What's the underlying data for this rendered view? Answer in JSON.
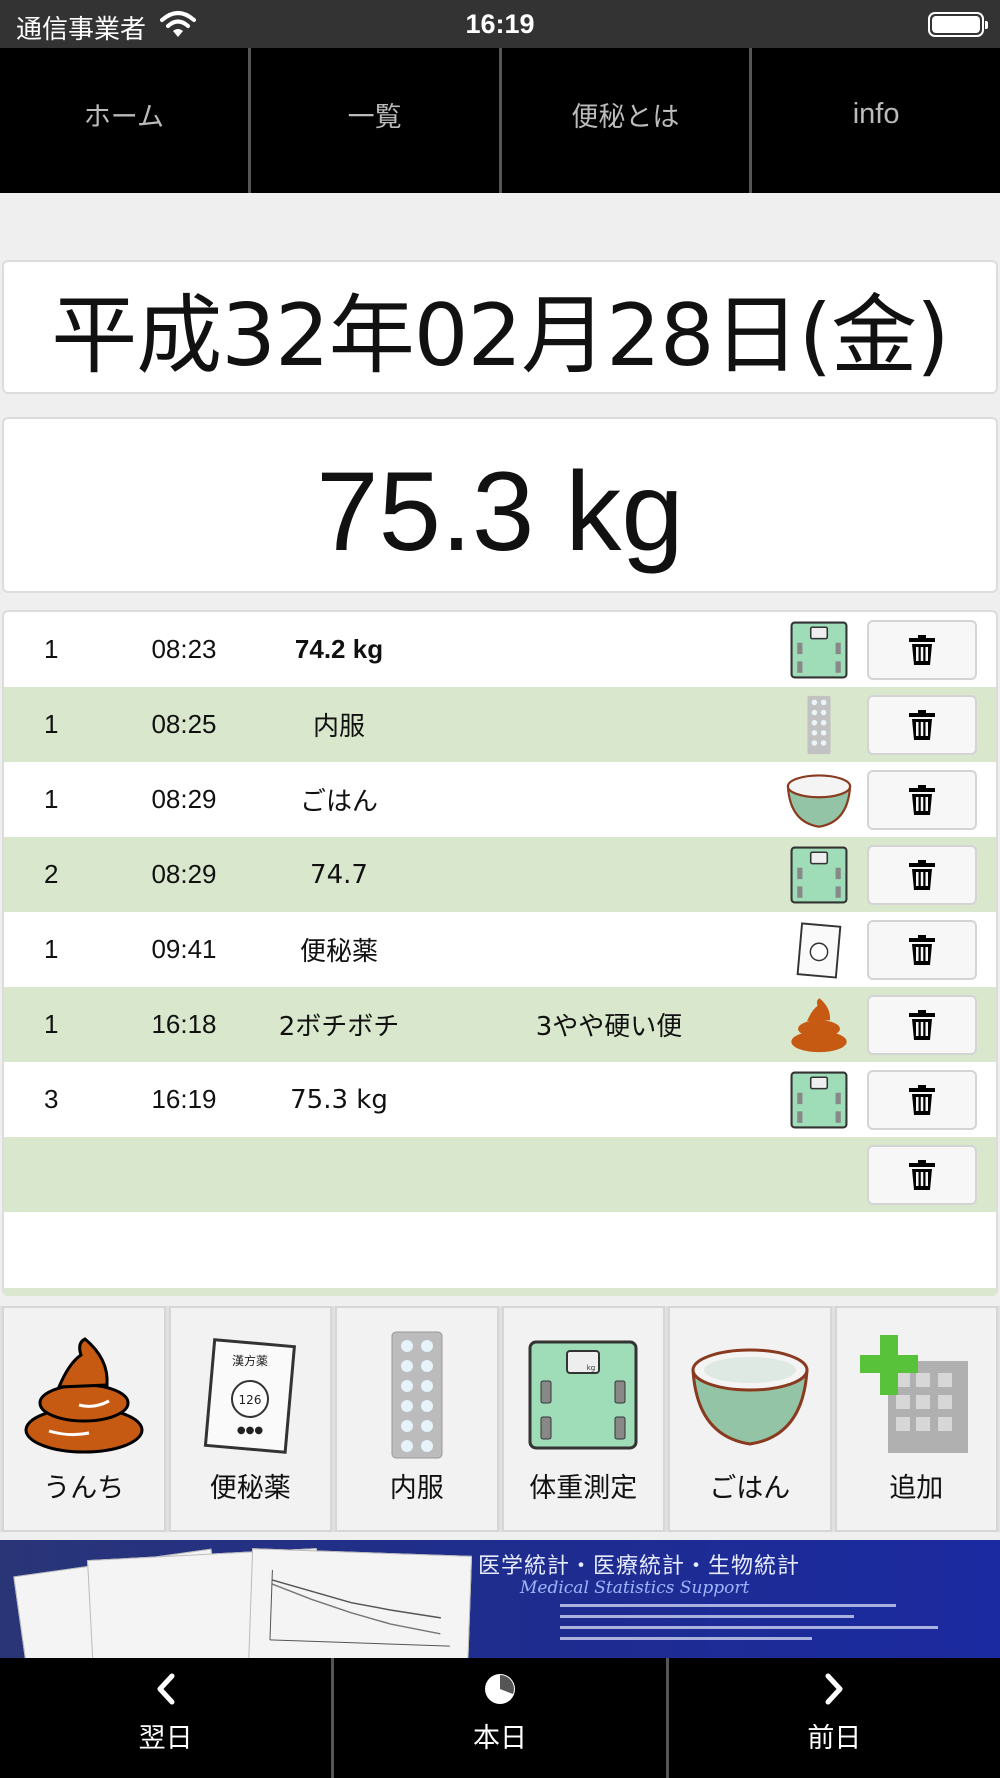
{
  "status_bar": {
    "carrier": "通信事業者",
    "time": "16:19"
  },
  "top_nav": {
    "tabs": [
      "ホーム",
      "一覧",
      "便秘とは",
      "info"
    ]
  },
  "date": "平成32年02月28日(金)",
  "current_weight": "75.3 kg",
  "records": [
    {
      "num": "1",
      "time": "08:23",
      "value": "74.2 kg",
      "detail": "",
      "icon": "scale-icon"
    },
    {
      "num": "1",
      "time": "08:25",
      "value": "内服",
      "detail": "",
      "icon": "pill-sheet-icon"
    },
    {
      "num": "1",
      "time": "08:29",
      "value": "ごはん",
      "detail": "",
      "icon": "rice-bowl-icon"
    },
    {
      "num": "2",
      "time": "08:29",
      "value": "74.7",
      "detail": "",
      "icon": "scale-icon"
    },
    {
      "num": "1",
      "time": "09:41",
      "value": "便秘薬",
      "detail": "",
      "icon": "kampo-medicine-icon"
    },
    {
      "num": "1",
      "time": "16:18",
      "value": "2ボチボチ",
      "detail": "3やや硬い便",
      "icon": "poop-icon"
    },
    {
      "num": "3",
      "time": "16:19",
      "value": "75.3 kg",
      "detail": "",
      "icon": "scale-icon"
    },
    {
      "num": "",
      "time": "",
      "value": "",
      "detail": "",
      "icon": ""
    }
  ],
  "actions": [
    {
      "label": "うんち",
      "icon": "poop-icon"
    },
    {
      "label": "便秘薬",
      "icon": "kampo-medicine-icon",
      "package_text": "漢方薬",
      "number": "126"
    },
    {
      "label": "内服",
      "icon": "pill-sheet-icon"
    },
    {
      "label": "体重測定",
      "icon": "scale-icon",
      "unit": "kg"
    },
    {
      "label": "ごはん",
      "icon": "rice-bowl-icon"
    },
    {
      "label": "追加",
      "icon": "add-icon"
    }
  ],
  "banner": {
    "title": "医学統計・医療統計・生物統計",
    "subtitle": "Medical Statistics Support"
  },
  "bottom_bar": {
    "buttons": [
      {
        "label": "翌日",
        "icon": "chevron-left-icon"
      },
      {
        "label": "本日",
        "icon": "clock-icon"
      },
      {
        "label": "前日",
        "icon": "chevron-right-icon"
      }
    ]
  },
  "colors": {
    "alt_row": "#d9e8cc",
    "nav_bg": "#000000",
    "poop": "#c65a12",
    "scale": "#9fdcb8"
  }
}
